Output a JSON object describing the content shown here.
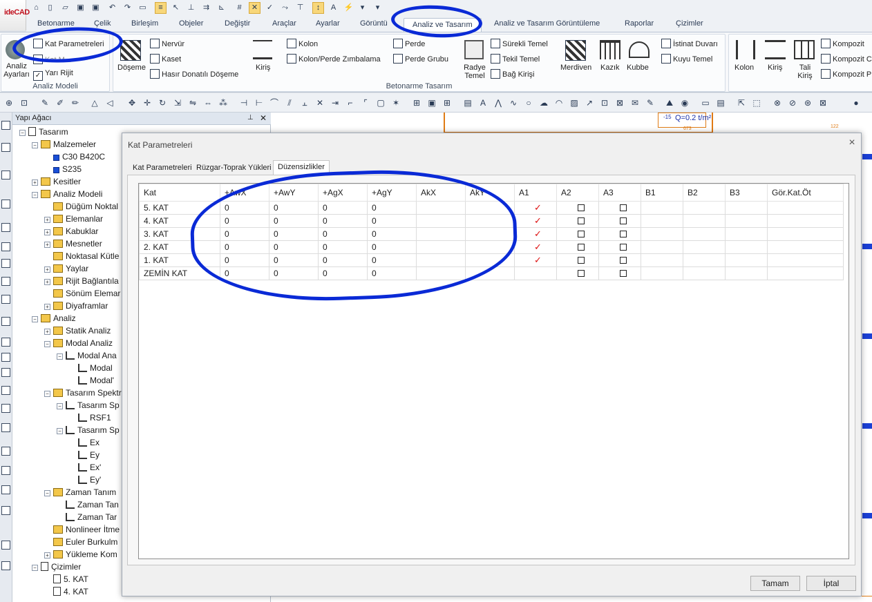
{
  "app": {
    "logo_text": "ideCAD",
    "accent": "#0a2ad6"
  },
  "ribbon_tabs": [
    "Betonarme",
    "Çelik",
    "Birleşim",
    "Objeler",
    "Değiştir",
    "Araçlar",
    "Ayarlar",
    "Görüntü",
    "Analiz ve Tasarım",
    "Analiz ve Tasarım Görüntüleme",
    "Raporlar",
    "Çizimler"
  ],
  "active_tab": "Analiz ve Tasarım",
  "ribbon": {
    "analysis_settings": "Analiz Ayarları",
    "kat_parametreleri": "Kat Parametreleri",
    "hidden_item": "Kat M...",
    "yari_rijit": "Yarı Rijit",
    "group_analiz_modeli": "Analiz Modeli",
    "doseme": "Döşeme",
    "nervur": "Nervür",
    "kaset": "Kaset",
    "hasir": "Hasır Donatılı Döşeme",
    "kiris": "Kiriş",
    "kolon": "Kolon",
    "kolon_perde": "Kolon/Perde Zımbalama",
    "perde": "Perde",
    "perde_grubu": "Perde Grubu",
    "radye": "Radye Temel",
    "surekli": "Sürekli Temel",
    "tekil": "Tekil Temel",
    "bag_kirisi": "Bağ Kirişi",
    "merdiven": "Merdiven",
    "kazik": "Kazık",
    "kubbe": "Kubbe",
    "istinat": "İstinat Duvarı",
    "kuyu": "Kuyu Temel",
    "group_betonarme": "Betonarme Tasarım",
    "celik_kolon": "Kolon",
    "celik_kiris": "Kiriş",
    "tali_kiris": "Tali Kiriş",
    "kompozit1": "Kompozit",
    "kompozit2": "Kompozit C",
    "kompozit3": "Kompozit P"
  },
  "tree": {
    "title": "Yapı Ağacı",
    "items": [
      {
        "label": "Tasarım",
        "level": 0,
        "exp": "-",
        "icon": "design-icon"
      },
      {
        "label": "Malzemeler",
        "level": 1,
        "exp": "-",
        "icon": "folder-icon"
      },
      {
        "label": "C30 B420C",
        "level": 2,
        "exp": "",
        "icon": "material-icon"
      },
      {
        "label": "S235",
        "level": 2,
        "exp": "",
        "icon": "material-icon"
      },
      {
        "label": "Kesitler",
        "level": 1,
        "exp": "+",
        "icon": "folder-icon"
      },
      {
        "label": "Analiz Modeli",
        "level": 1,
        "exp": "-",
        "icon": "folder-icon"
      },
      {
        "label": "Düğüm Noktal",
        "level": 2,
        "exp": "",
        "icon": "folder-icon"
      },
      {
        "label": "Elemanlar",
        "level": 2,
        "exp": "+",
        "icon": "folder-icon"
      },
      {
        "label": "Kabuklar",
        "level": 2,
        "exp": "+",
        "icon": "folder-icon"
      },
      {
        "label": "Mesnetler",
        "level": 2,
        "exp": "+",
        "icon": "folder-icon"
      },
      {
        "label": "Noktasal Kütle",
        "level": 2,
        "exp": "",
        "icon": "folder-icon"
      },
      {
        "label": "Yaylar",
        "level": 2,
        "exp": "+",
        "icon": "folder-icon"
      },
      {
        "label": "Rijit Bağlantıla",
        "level": 2,
        "exp": "+",
        "icon": "folder-icon"
      },
      {
        "label": "Sönüm Elemar",
        "level": 2,
        "exp": "",
        "icon": "folder-icon"
      },
      {
        "label": "Diyaframlar",
        "level": 2,
        "exp": "+",
        "icon": "folder-icon"
      },
      {
        "label": "Analiz",
        "level": 1,
        "exp": "-",
        "icon": "folder-icon"
      },
      {
        "label": "Statik Analiz",
        "level": 2,
        "exp": "+",
        "icon": "folder-icon"
      },
      {
        "label": "Modal Analiz",
        "level": 2,
        "exp": "-",
        "icon": "folder-icon"
      },
      {
        "label": "Modal Ana",
        "level": 3,
        "exp": "-",
        "icon": "chart-icon"
      },
      {
        "label": "Modal",
        "level": 4,
        "exp": "",
        "icon": "chart-icon"
      },
      {
        "label": "Modal'",
        "level": 4,
        "exp": "",
        "icon": "chart-icon"
      },
      {
        "label": "Tasarım Spektr",
        "level": 2,
        "exp": "-",
        "icon": "folder-icon"
      },
      {
        "label": "Tasarım Sp",
        "level": 3,
        "exp": "-",
        "icon": "chart-icon"
      },
      {
        "label": "RSF1",
        "level": 4,
        "exp": "",
        "icon": "chart-icon"
      },
      {
        "label": "Tasarım Sp",
        "level": 3,
        "exp": "-",
        "icon": "chart-icon"
      },
      {
        "label": "Ex",
        "level": 4,
        "exp": "",
        "icon": "chart-icon"
      },
      {
        "label": "Ey",
        "level": 4,
        "exp": "",
        "icon": "chart-icon"
      },
      {
        "label": "Ex'",
        "level": 4,
        "exp": "",
        "icon": "chart-icon"
      },
      {
        "label": "Ey'",
        "level": 4,
        "exp": "",
        "icon": "chart-icon"
      },
      {
        "label": "Zaman Tanım",
        "level": 2,
        "exp": "-",
        "icon": "folder-icon"
      },
      {
        "label": "Zaman Tan",
        "level": 3,
        "exp": "",
        "icon": "chart-icon"
      },
      {
        "label": "Zaman Tar",
        "level": 3,
        "exp": "",
        "icon": "chart-icon"
      },
      {
        "label": "Nonlineer İtme",
        "level": 2,
        "exp": "",
        "icon": "folder-icon"
      },
      {
        "label": "Euler Burkulm",
        "level": 2,
        "exp": "",
        "icon": "folder-icon"
      },
      {
        "label": "Yükleme Kom",
        "level": 2,
        "exp": "+",
        "icon": "folder-icon"
      },
      {
        "label": "Çizimler",
        "level": 1,
        "exp": "-",
        "icon": "drawings-icon"
      },
      {
        "label": "5. KAT",
        "level": 2,
        "exp": "",
        "icon": "doc-icon"
      },
      {
        "label": "4. KAT",
        "level": 2,
        "exp": "",
        "icon": "doc-icon"
      }
    ]
  },
  "dialog": {
    "title": "Kat Parametreleri",
    "tabs": [
      "Kat Parametreleri",
      "Rüzgar-Toprak Yükleri",
      "Düzensizlikler"
    ],
    "active_tab": "Düzensizlikler",
    "columns": [
      "Kat",
      "+AwX",
      "+AwY",
      "+AgX",
      "+AgY",
      "AkX",
      "AkY",
      "A1",
      "A2",
      "A3",
      "B1",
      "B2",
      "B3",
      "Gör.Kat.Öt"
    ],
    "rows": [
      {
        "kat": "5. KAT",
        "awx": "0",
        "awy": "0",
        "agx": "0",
        "agy": "0",
        "akx": "",
        "aky": "",
        "a1": true,
        "a2": false,
        "a3": false
      },
      {
        "kat": "4. KAT",
        "awx": "0",
        "awy": "0",
        "agx": "0",
        "agy": "0",
        "akx": "",
        "aky": "",
        "a1": true,
        "a2": false,
        "a3": false
      },
      {
        "kat": "3. KAT",
        "awx": "0",
        "awy": "0",
        "agx": "0",
        "agy": "0",
        "akx": "",
        "aky": "",
        "a1": true,
        "a2": false,
        "a3": false
      },
      {
        "kat": "2. KAT",
        "awx": "0",
        "awy": "0",
        "agx": "0",
        "agy": "0",
        "akx": "",
        "aky": "",
        "a1": true,
        "a2": false,
        "a3": false
      },
      {
        "kat": "1. KAT",
        "awx": "0",
        "awy": "0",
        "agx": "0",
        "agy": "0",
        "akx": "",
        "aky": "",
        "a1": true,
        "a2": false,
        "a3": false
      },
      {
        "kat": "ZEMİN KAT",
        "awx": "0",
        "awy": "0",
        "agx": "0",
        "agy": "0",
        "akx": "",
        "aky": "",
        "a1": null,
        "a2": false,
        "a3": false
      }
    ],
    "ok_label": "Tamam",
    "cancel_label": "İptal"
  },
  "cad_labels": {
    "q": "Q=0.2 t/m²",
    "s15": "-15",
    "v673": "673",
    "v122": "122"
  }
}
